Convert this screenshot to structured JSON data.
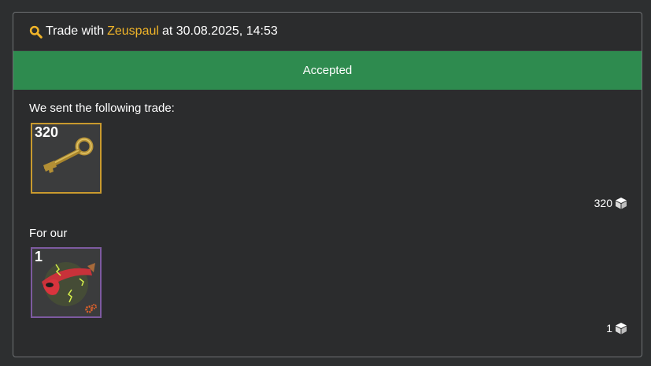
{
  "header": {
    "prefix": "Trade with",
    "user": "Zeuspaul",
    "suffix": "at 30.08.2025, 14:53"
  },
  "status": {
    "label": "Accepted",
    "color": "#2e8b4f"
  },
  "sent": {
    "label": "We sent the following trade:",
    "items": [
      {
        "quantity": "320",
        "icon": "key-icon",
        "border_color": "#c99a2e"
      }
    ],
    "total": "320"
  },
  "received": {
    "label": "For our",
    "items": [
      {
        "quantity": "1",
        "icon": "red-mask-icon",
        "border_color": "#7d5aa0",
        "effect_icon": "gear-icon"
      }
    ],
    "total": "1"
  },
  "colors": {
    "accent_user": "#f0b429",
    "search_icon": "#f0b429"
  }
}
